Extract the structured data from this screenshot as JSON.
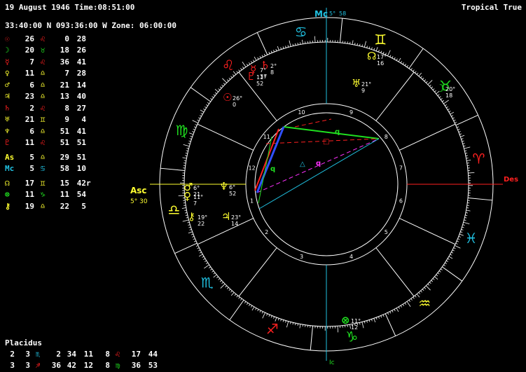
{
  "header": {
    "date_time": "19 August 1946 Time:08:51:00",
    "location": "33:40:00 N 093:36:00 W Zone: 06:00:00",
    "system": "Tropical True"
  },
  "colors": {
    "fire": "#ff2020",
    "earth": "#20e020",
    "air": "#ffff30",
    "water": "#20c0e0",
    "magenta": "#ff30ff",
    "blue": "#3050ff",
    "white": "#ffffff"
  },
  "planets": [
    {
      "glyph": "☉",
      "color": "#ff2020",
      "deg": "26",
      "sign": "♌",
      "sign_color": "#ff2020",
      "deg2": "0",
      "min": "28",
      "r": ""
    },
    {
      "glyph": "☽",
      "color": "#20e020",
      "deg": "20",
      "sign": "♉",
      "sign_color": "#20e020",
      "deg2": "18",
      "min": "26",
      "r": ""
    },
    {
      "glyph": "☿",
      "color": "#ff2020",
      "deg": "7",
      "sign": "♌",
      "sign_color": "#ff2020",
      "deg2": "36",
      "min": "41",
      "r": ""
    },
    {
      "glyph": "♀",
      "color": "#ffff30",
      "deg": "11",
      "sign": "♎",
      "sign_color": "#ffff30",
      "deg2": "7",
      "min": "28",
      "r": ""
    },
    {
      "glyph": "♂",
      "color": "#ffff30",
      "deg": "6",
      "sign": "♎",
      "sign_color": "#ffff30",
      "deg2": "21",
      "min": "14",
      "r": ""
    },
    {
      "glyph": "♃",
      "color": "#ffff30",
      "deg": "23",
      "sign": "♎",
      "sign_color": "#ffff30",
      "deg2": "13",
      "min": "40",
      "r": ""
    },
    {
      "glyph": "♄",
      "color": "#ff2020",
      "deg": "2",
      "sign": "♌",
      "sign_color": "#ff2020",
      "deg2": "8",
      "min": "27",
      "r": ""
    },
    {
      "glyph": "♅",
      "color": "#ffff30",
      "deg": "21",
      "sign": "♊",
      "sign_color": "#ffff30",
      "deg2": "9",
      "min": "4",
      "r": ""
    },
    {
      "glyph": "♆",
      "color": "#ffff30",
      "deg": "6",
      "sign": "♎",
      "sign_color": "#ffff30",
      "deg2": "51",
      "min": "41",
      "r": ""
    },
    {
      "glyph": "♇",
      "color": "#ff2020",
      "deg": "11",
      "sign": "♌",
      "sign_color": "#ff2020",
      "deg2": "51",
      "min": "51",
      "r": ""
    }
  ],
  "angles": [
    {
      "glyph": "As",
      "color": "#ffff30",
      "deg": "5",
      "sign": "♎",
      "sign_color": "#ffff30",
      "deg2": "29",
      "min": "51",
      "r": ""
    },
    {
      "glyph": "Mc",
      "color": "#20c0e0",
      "deg": "5",
      "sign": "♋",
      "sign_color": "#20c0e0",
      "deg2": "58",
      "min": "10",
      "r": ""
    }
  ],
  "points": [
    {
      "glyph": "☊",
      "color": "#ffff30",
      "deg": "17",
      "sign": "♊",
      "sign_color": "#ffff30",
      "deg2": "15",
      "min": "42",
      "r": "r"
    },
    {
      "glyph": "⊗",
      "color": "#20e020",
      "deg": "11",
      "sign": "♑",
      "sign_color": "#20e020",
      "deg2": "11",
      "min": "54",
      "r": ""
    },
    {
      "glyph": "⚷",
      "color": "#ffff30",
      "deg": "19",
      "sign": "♎",
      "sign_color": "#ffff30",
      "deg2": "22",
      "min": "5",
      "r": ""
    }
  ],
  "houses": {
    "title": "Placidus",
    "rows": [
      {
        "a": "2",
        "b": "3",
        "s": "♏",
        "sc": "#20c0e0",
        "c": "2",
        "d": "34",
        "e": "11",
        "f": "8",
        "s2": "♌",
        "s2c": "#ff2020",
        "g": "17",
        "h": "44"
      },
      {
        "a": "3",
        "b": "3",
        "s": "♐",
        "sc": "#ff2020",
        "c": "36",
        "d": "42",
        "e": "12",
        "f": "8",
        "s2": "♍",
        "s2c": "#20e020",
        "g": "36",
        "h": "53"
      }
    ]
  },
  "wheel": {
    "mc_label": "Mc",
    "mc_deg": "5",
    "mc_min": "58",
    "ic_label": "Ic",
    "asc_label": "Asc",
    "asc_deg": "5",
    "asc_min": "30",
    "des_label": "Des",
    "zodiac": [
      {
        "glyph": "♋",
        "color": "#20c0e0"
      },
      {
        "glyph": "♊",
        "color": "#ffff30"
      },
      {
        "glyph": "♉",
        "color": "#20e020"
      },
      {
        "glyph": "♈",
        "color": "#ff2020"
      },
      {
        "glyph": "♓",
        "color": "#20c0e0"
      },
      {
        "glyph": "♒",
        "color": "#ffff30"
      },
      {
        "glyph": "♑",
        "color": "#20e020"
      },
      {
        "glyph": "♐",
        "color": "#ff2020"
      },
      {
        "glyph": "♏",
        "color": "#20c0e0"
      },
      {
        "glyph": "♎",
        "color": "#ffff30"
      },
      {
        "glyph": "♍",
        "color": "#20e020"
      },
      {
        "glyph": "♌",
        "color": "#ff2020"
      }
    ],
    "house_numbers": [
      "1",
      "2",
      "3",
      "4",
      "5",
      "6",
      "7",
      "8",
      "9",
      "10",
      "11",
      "12"
    ],
    "placements": [
      {
        "glyph": "♇",
        "color": "#ff2020",
        "deg": "11",
        "min": "52"
      },
      {
        "glyph": "☿",
        "color": "#ff2020",
        "deg": "7",
        "min": "37"
      },
      {
        "glyph": "♄",
        "color": "#ff2020",
        "deg": "2",
        "min": "8"
      },
      {
        "glyph": "☉",
        "color": "#ff2020",
        "deg": "26",
        "min": "0"
      },
      {
        "glyph": "☊",
        "color": "#ffff30",
        "deg": "17",
        "min": "16"
      },
      {
        "glyph": "♅",
        "color": "#ffff30",
        "deg": "21",
        "min": "9"
      },
      {
        "glyph": "☽",
        "color": "#20e020",
        "deg": "20",
        "min": "18"
      },
      {
        "glyph": "♂",
        "color": "#ffff30",
        "deg": "6",
        "min": "21"
      },
      {
        "glyph": "♆",
        "color": "#ffff30",
        "deg": "6",
        "min": "52"
      },
      {
        "glyph": "♀",
        "color": "#ffff30",
        "deg": "11",
        "min": "7"
      },
      {
        "glyph": "⚷",
        "color": "#ffff30",
        "deg": "19",
        "min": "22"
      },
      {
        "glyph": "♃",
        "color": "#ffff30",
        "deg": "23",
        "min": "14"
      },
      {
        "glyph": "⊗",
        "color": "#20e020",
        "deg": "11",
        "min": "12"
      }
    ],
    "aspect_marks": [
      "q",
      "q",
      "q",
      "□",
      "△"
    ]
  }
}
